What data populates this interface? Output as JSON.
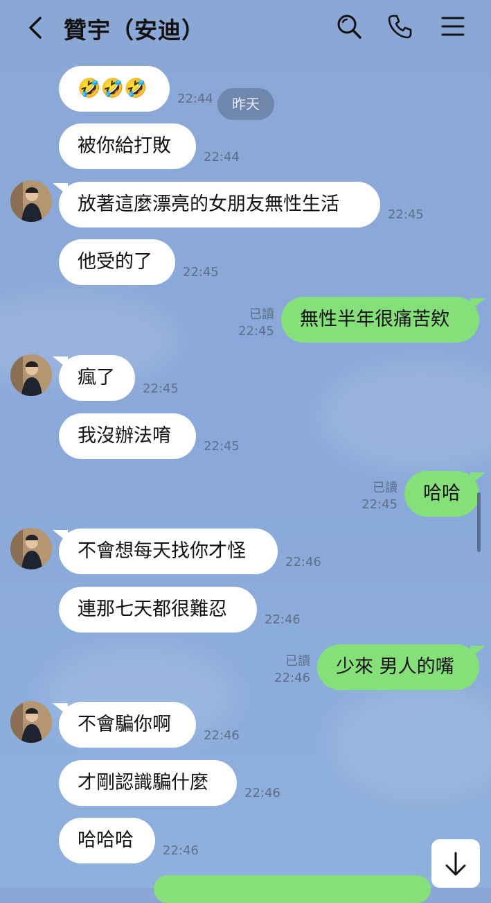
{
  "header": {
    "title": "贊宇（安迪）",
    "icons": [
      "back-icon",
      "search-icon",
      "phone-icon",
      "menu-icon"
    ]
  },
  "date_pill": "昨天",
  "messages": [
    {
      "side": "in",
      "text": "🤣🤣🤣",
      "time": "22:44"
    },
    {
      "side": "in",
      "text": "被你給打敗",
      "time": "22:44"
    },
    {
      "side": "in",
      "text": "放著這麼漂亮的女朋友無性生活",
      "time": "22:45"
    },
    {
      "side": "in",
      "text": "他受的了",
      "time": "22:45"
    },
    {
      "side": "out",
      "text": "無性半年很痛苦欸",
      "time": "22:45",
      "read": "已讀"
    },
    {
      "side": "in",
      "text": "瘋了",
      "time": "22:45"
    },
    {
      "side": "in",
      "text": "我沒辦法唷",
      "time": "22:45"
    },
    {
      "side": "out",
      "text": "哈哈",
      "time": "22:45",
      "read": "已讀"
    },
    {
      "side": "in",
      "text": "不會想每天找你才怪",
      "time": "22:46"
    },
    {
      "side": "in",
      "text": "連那七天都很難忍",
      "time": "22:46"
    },
    {
      "side": "out",
      "text": "少來 男人的嘴",
      "time": "22:46",
      "read": "已讀"
    },
    {
      "side": "in",
      "text": "不會騙你啊",
      "time": "22:46"
    },
    {
      "side": "in",
      "text": "才剛認識騙什麼",
      "time": "22:46"
    },
    {
      "side": "in",
      "text": "哈哈哈",
      "time": "22:46"
    }
  ],
  "colors": {
    "background": "#8aa9da",
    "incoming": "#ffffff",
    "outgoing": "#86e07a"
  }
}
